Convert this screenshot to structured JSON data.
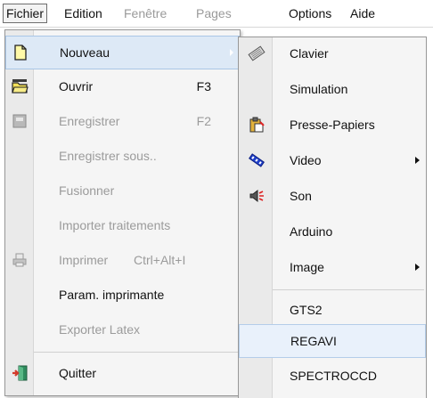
{
  "menubar": {
    "items": [
      {
        "label": "Fichier",
        "state": "active"
      },
      {
        "label": "Edition",
        "state": "normal"
      },
      {
        "label": "Fenêtre",
        "state": "disabled"
      },
      {
        "label": "Pages",
        "state": "disabled"
      },
      {
        "label": "Options",
        "state": "normal"
      },
      {
        "label": "Aide",
        "state": "normal"
      }
    ]
  },
  "fichier_menu": {
    "items": [
      {
        "label": "Nouveau",
        "shortcut": "",
        "icon": "new-document-icon",
        "enabled": true,
        "submenu": true,
        "highlighted": true
      },
      {
        "label": "Ouvrir",
        "shortcut": "F3",
        "icon": "open-folder-icon",
        "enabled": true
      },
      {
        "label": "Enregistrer",
        "shortcut": "F2",
        "icon": "save-icon",
        "enabled": false
      },
      {
        "label": "Enregistrer sous..",
        "shortcut": "",
        "icon": "",
        "enabled": false
      },
      {
        "label": "Fusionner",
        "shortcut": "",
        "icon": "",
        "enabled": false
      },
      {
        "label": "Importer traitements",
        "shortcut": "",
        "icon": "",
        "enabled": false
      },
      {
        "label": "Imprimer",
        "shortcut": "Ctrl+Alt+I",
        "icon": "printer-icon",
        "enabled": false
      },
      {
        "label": "Param. imprimante",
        "shortcut": "",
        "icon": "",
        "enabled": true
      },
      {
        "label": "Exporter Latex",
        "shortcut": "",
        "icon": "",
        "enabled": false
      },
      {
        "label": "Quitter",
        "shortcut": "",
        "icon": "exit-door-icon",
        "enabled": true
      }
    ]
  },
  "nouveau_submenu": {
    "items": [
      {
        "label": "Clavier",
        "icon": "keyboard-icon",
        "has_submenu": false
      },
      {
        "label": "Simulation",
        "icon": "",
        "has_submenu": false
      },
      {
        "label": "Presse-Papiers",
        "icon": "clipboard-icon",
        "has_submenu": false
      },
      {
        "label": "Video",
        "icon": "video-icon",
        "has_submenu": true
      },
      {
        "label": "Son",
        "icon": "sound-icon",
        "has_submenu": false
      },
      {
        "label": "Arduino",
        "icon": "",
        "has_submenu": false
      },
      {
        "label": "Image",
        "icon": "",
        "has_submenu": true
      },
      {
        "label": "GTS2",
        "icon": "",
        "has_submenu": false
      },
      {
        "label": "REGAVI",
        "icon": "",
        "has_submenu": false,
        "hovered": true
      },
      {
        "label": "SPECTROCCD",
        "icon": "",
        "has_submenu": false
      }
    ]
  },
  "colors": {
    "highlight": "#dde9f6",
    "disabled_text": "#9b9b9b",
    "menu_bg": "#f5f5f5"
  }
}
